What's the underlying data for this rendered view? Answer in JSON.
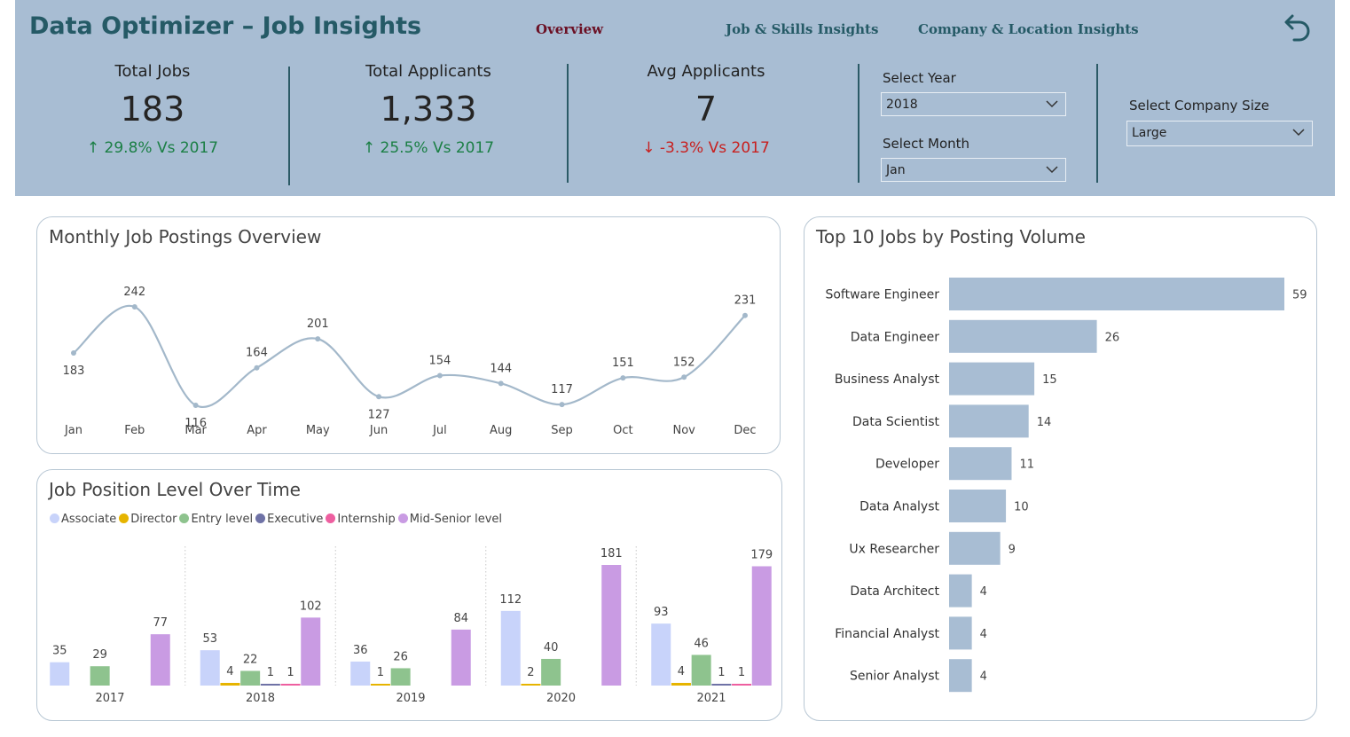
{
  "header": {
    "title": "Data Optimizer – Job Insights",
    "tabs": [
      {
        "label": "Overview",
        "active": true
      },
      {
        "label": "Job & Skills Insights",
        "active": false
      },
      {
        "label": "Company & Location Insights",
        "active": false
      }
    ],
    "back_icon": "undo-arrow-icon"
  },
  "kpis": [
    {
      "label": "Total Jobs",
      "value": "183",
      "delta": "↑ 29.8% Vs 2017",
      "direction": "up"
    },
    {
      "label": "Total Applicants",
      "value": "1,333",
      "delta": "↑ 25.5% Vs 2017",
      "direction": "up"
    },
    {
      "label": "Avg Applicants",
      "value": "7",
      "delta": "↓ -3.3% Vs 2017",
      "direction": "down"
    }
  ],
  "slicers": {
    "year": {
      "label": "Select Year",
      "value": "2018"
    },
    "month": {
      "label": "Select Month",
      "value": "Jan"
    },
    "company_size": {
      "label": "Select Company Size",
      "value": "Large"
    }
  },
  "colors": {
    "header_bg": "#a8bdd3",
    "title": "#255a66",
    "active_tab": "#6b1024",
    "up": "#1b7f45",
    "down": "#c8201f",
    "line": "#a3b8ca",
    "bar": "#a8bdd3"
  },
  "chart_data": [
    {
      "type": "line",
      "title": "Monthly Job Postings Overview",
      "categories": [
        "Jan",
        "Feb",
        "Mar",
        "Apr",
        "May",
        "Jun",
        "Jul",
        "Aug",
        "Sep",
        "Oct",
        "Nov",
        "Dec"
      ],
      "values": [
        183,
        242,
        116,
        164,
        201,
        127,
        154,
        144,
        117,
        151,
        152,
        231
      ],
      "data_labels": true,
      "grid": false
    },
    {
      "type": "bar",
      "title": "Job Position Level Over Time",
      "categories": [
        "2017",
        "2018",
        "2019",
        "2020",
        "2021"
      ],
      "legend_position": "top-left",
      "series": [
        {
          "name": "Associate",
          "color": "#c8d3fa",
          "values": [
            35,
            53,
            36,
            112,
            93
          ]
        },
        {
          "name": "Director",
          "color": "#e6b400",
          "values": [
            null,
            4,
            1,
            2,
            4
          ]
        },
        {
          "name": "Entry level",
          "color": "#8ec38e",
          "values": [
            29,
            22,
            26,
            40,
            46
          ]
        },
        {
          "name": "Executive",
          "color": "#6f72a6",
          "values": [
            null,
            1,
            null,
            null,
            1
          ]
        },
        {
          "name": "Internship",
          "color": "#ee5fa0",
          "values": [
            null,
            1,
            null,
            null,
            1
          ]
        },
        {
          "name": "Mid-Senior level",
          "color": "#c99be3",
          "values": [
            77,
            102,
            84,
            181,
            179
          ]
        }
      ]
    },
    {
      "type": "bar",
      "orientation": "horizontal",
      "title": "Top 10 Jobs by Posting Volume",
      "categories": [
        "Software Engineer",
        "Data Engineer",
        "Business Analyst",
        "Data Scientist",
        "Developer",
        "Data Analyst",
        "Ux Researcher",
        "Data Architect",
        "Financial Analyst",
        "Senior Analyst"
      ],
      "values": [
        59,
        26,
        15,
        14,
        11,
        10,
        9,
        4,
        4,
        4
      ]
    }
  ]
}
